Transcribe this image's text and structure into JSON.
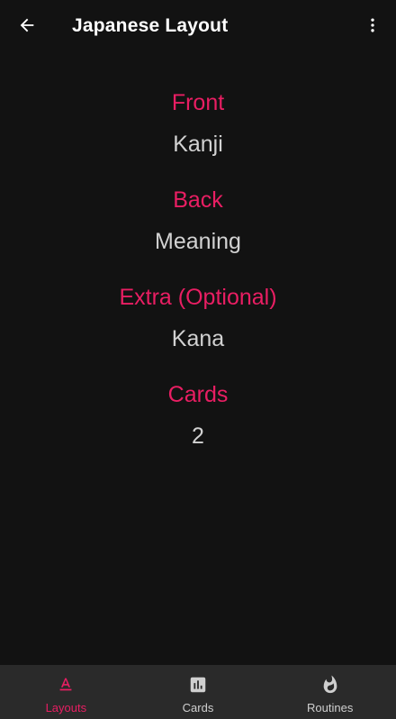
{
  "colors": {
    "background": "#121212",
    "accent": "#e91e63",
    "text_primary": "#ffffff",
    "text_value": "#d2d2d2",
    "nav_background": "#2a2a2a"
  },
  "appbar": {
    "title": "Japanese Layout",
    "back_icon": "arrow-back-icon",
    "menu_icon": "more-vert-icon"
  },
  "fields": [
    {
      "label": "Front",
      "value": "Kanji"
    },
    {
      "label": "Back",
      "value": "Meaning"
    },
    {
      "label": "Extra (Optional)",
      "value": "Kana"
    },
    {
      "label": "Cards",
      "value": "2"
    }
  ],
  "bottom_nav": {
    "items": [
      {
        "label": "Layouts",
        "icon": "text-format-icon",
        "active": true
      },
      {
        "label": "Cards",
        "icon": "bar-chart-icon",
        "active": false
      },
      {
        "label": "Routines",
        "icon": "flame-icon",
        "active": false
      }
    ]
  }
}
